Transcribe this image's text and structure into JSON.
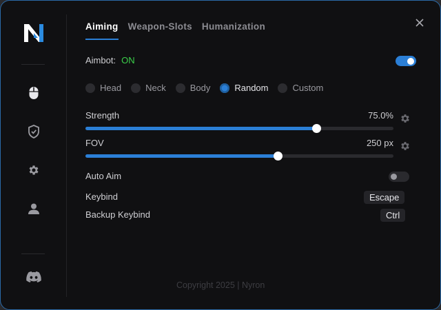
{
  "tabs": [
    {
      "label": "Aiming",
      "active": true
    },
    {
      "label": "Weapon-Slots",
      "active": false
    },
    {
      "label": "Humanization",
      "active": false
    }
  ],
  "aimbot": {
    "label": "Aimbot:",
    "status": "ON",
    "enabled": true
  },
  "targets": {
    "options": [
      "Head",
      "Neck",
      "Body",
      "Random",
      "Custom"
    ],
    "selected": "Random"
  },
  "strength": {
    "label": "Strength",
    "value_text": "75.0%",
    "fraction": 0.75
  },
  "fov": {
    "label": "FOV",
    "value_text": "250 px",
    "fraction": 0.625
  },
  "auto_aim": {
    "label": "Auto Aim",
    "enabled": false
  },
  "keybind": {
    "label": "Keybind",
    "value": "Escape"
  },
  "backup_keybind": {
    "label": "Backup Keybind",
    "value": "Ctrl"
  },
  "footer": {
    "copyright": "Copyright 2025 | Nyron"
  },
  "sidebar": {
    "icons": [
      "logo-icon",
      "mouse-icon",
      "shield-icon",
      "gear-icon",
      "user-icon",
      "discord-icon"
    ]
  },
  "colors": {
    "accent": "#2b7fd6",
    "on": "#3bd04a",
    "background": "#101012",
    "border": "#2b6aa8"
  }
}
